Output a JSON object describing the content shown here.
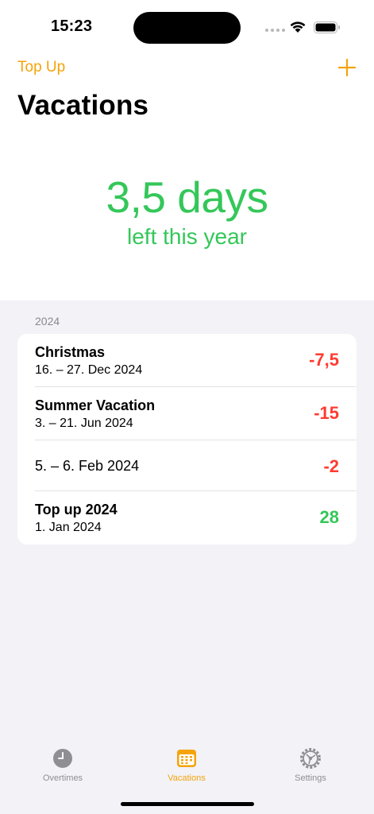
{
  "status_bar": {
    "time": "15:23"
  },
  "nav": {
    "left_button": "Top Up",
    "add_icon": "plus-icon"
  },
  "page": {
    "title": "Vacations"
  },
  "summary": {
    "days": "3,5 days",
    "subtitle": "left this year"
  },
  "section": {
    "year": "2024"
  },
  "entries": [
    {
      "title": "Christmas",
      "date": "16. – 27. Dec 2024",
      "value": "-7,5",
      "kind": "negative"
    },
    {
      "title": "Summer Vacation",
      "date": "3. – 21. Jun 2024",
      "value": "-15",
      "kind": "negative"
    },
    {
      "title": "",
      "date": "5. – 6. Feb 2024",
      "value": "-2",
      "kind": "negative"
    },
    {
      "title": "Top up 2024",
      "date": "1. Jan 2024",
      "value": "28",
      "kind": "positive"
    }
  ],
  "tabs": [
    {
      "label": "Overtimes",
      "icon": "clock-icon",
      "active": false
    },
    {
      "label": "Vacations",
      "icon": "calendar-icon",
      "active": true
    },
    {
      "label": "Settings",
      "icon": "gear-icon",
      "active": false
    }
  ],
  "colors": {
    "accent": "#f5a30a",
    "positive": "#34c759",
    "negative": "#ff3b30",
    "background": "#f2f2f7"
  }
}
